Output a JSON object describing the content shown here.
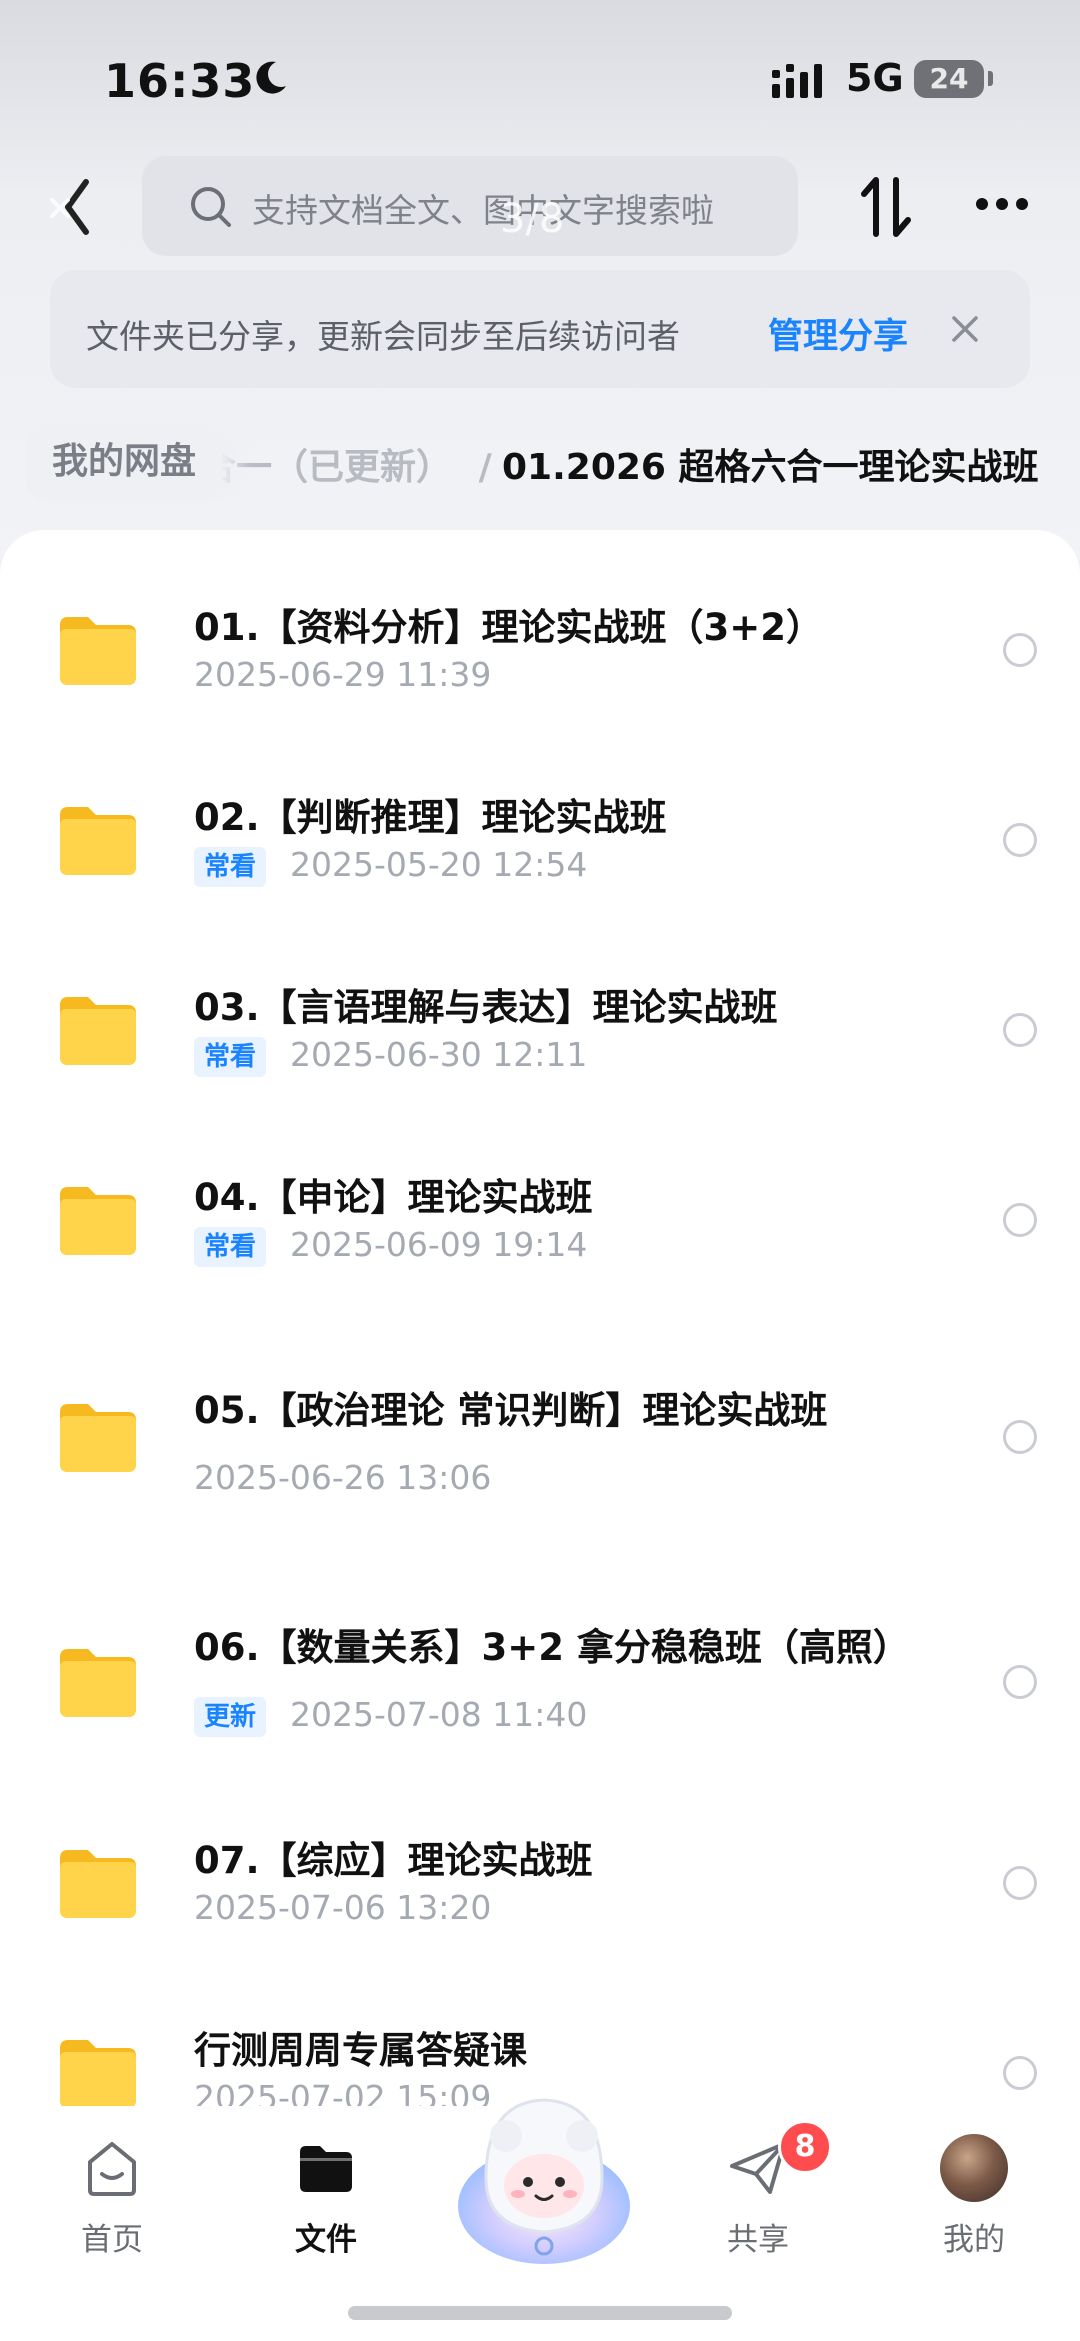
{
  "status_bar": {
    "time": "16:33",
    "network": "5G",
    "battery": "24"
  },
  "toolbar": {
    "search_placeholder": "支持文档全文、图中文字搜索啦",
    "page_indicator": "3/8"
  },
  "share_banner": {
    "text": "文件夹已分享，更新会同步至后续访问者",
    "manage_label": "管理分享"
  },
  "breadcrumb": {
    "root": "我的网盘",
    "previous": "合一（已更新）",
    "separator": "/",
    "current": "01.2026 超格六合一理论实战班"
  },
  "files": [
    {
      "name": "01.【资料分析】理论实战班（3+2）",
      "tag": "",
      "date": "2025-06-29 11:39"
    },
    {
      "name": "02.【判断推理】理论实战班",
      "tag": "常看",
      "date": "2025-05-20 12:54"
    },
    {
      "name": "03.【言语理解与表达】理论实战班",
      "tag": "常看",
      "date": "2025-06-30 12:11"
    },
    {
      "name": "04.【申论】理论实战班",
      "tag": "常看",
      "date": "2025-06-09 19:14"
    },
    {
      "name": "05.【政治理论 常识判断】理论实战班",
      "tag": "",
      "date": "2025-06-26 13:06"
    },
    {
      "name": "06.【数量关系】3+2 拿分稳稳班（高照）",
      "tag": "更新",
      "date": "2025-07-08 11:40"
    },
    {
      "name": "07.【综应】理论实战班",
      "tag": "",
      "date": "2025-07-06 13:20"
    },
    {
      "name": "行测周周专属答疑课",
      "tag": "",
      "date": "2025-07-02 15:09"
    }
  ],
  "bottom_nav": {
    "home": "首页",
    "files": "文件",
    "share": "共享",
    "share_badge": "8",
    "me": "我的"
  },
  "colors": {
    "accent": "#1a84ff",
    "folder": "#ffc93c",
    "badge": "#ff4d4f"
  }
}
